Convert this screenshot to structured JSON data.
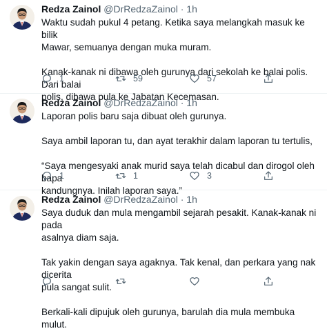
{
  "tweets": [
    {
      "name": "Redza Zainol",
      "handle": "@DrRedzaZainol",
      "dot": "·",
      "time": "1h",
      "text": "Waktu sudah pukul 4 petang. Ketika saya melangkah masuk ke bilik\nMawar, semuanya dengan muka muram.\n\nKanak-kanak ni dibawa oleh gurunya dari sekolah ke balai polis. Dari balai\npolis, dibawa pula ke Jabatan Kecemasan.",
      "replies": "1",
      "retweets": "59",
      "likes": "57"
    },
    {
      "name": "Redza Zainol",
      "handle": "@DrRedzaZainol",
      "dot": "·",
      "time": "1h",
      "text": "Laporan polis baru saja dibuat oleh gurunya.\n\nSaya ambil laporan tu, dan ayat terakhir dalam laporan tu tertulis,\n\n“Saya mengesyaki anak murid saya telah dicabul dan dirogol oleh bapa\nkandungnya. Inilah laporan saya.”",
      "replies": "1",
      "retweets": "1",
      "likes": "3"
    },
    {
      "name": "Redza Zainol",
      "handle": "@DrRedzaZainol",
      "dot": "·",
      "time": "1h",
      "text": "Saya duduk dan mula mengambil sejarah pesakit. Kanak-kanak ni pada\nasalnya diam saja.\n\nTak yakin dengan saya agaknya. Tak kenal, dan perkara yang nak dicerita\npula sangat sulit.\n\nBerkali-kali dipujuk oleh gurunya, barulah dia mula membuka mulut.",
      "replies": "",
      "retweets": "",
      "likes": ""
    }
  ],
  "icons": {
    "reply": "reply-icon",
    "retweet": "retweet-icon",
    "like": "heart-icon",
    "share": "share-icon"
  },
  "colors": {
    "text": "#0f1419",
    "secondary": "#536471",
    "divider": "#eff3f4"
  }
}
